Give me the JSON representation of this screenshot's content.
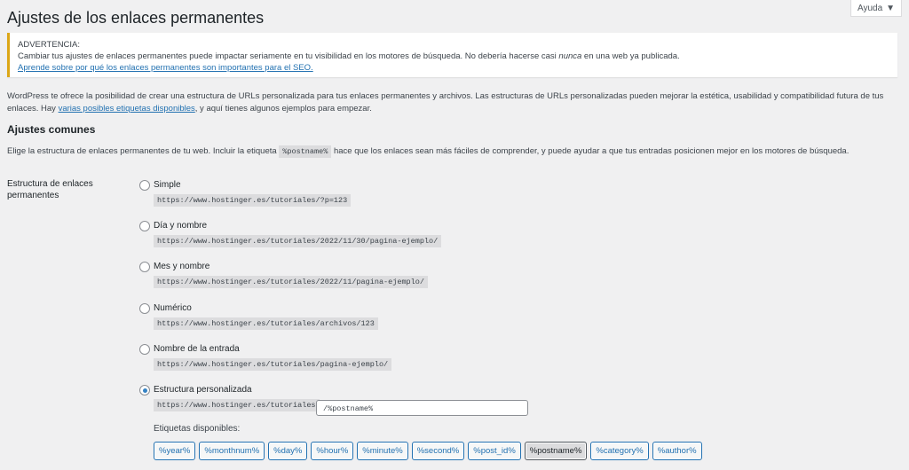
{
  "title": "Ajustes de los enlaces permanentes",
  "help_label": "Ayuda",
  "notice": {
    "heading": "ADVERTENCIA:",
    "text_before": "Cambiar tus ajustes de enlaces permanentes puede impactar seriamente en tu visibilidad en los motores de búsqueda. No debería hacerse casi ",
    "text_em": "nunca",
    "text_after": " en una web ya publicada.",
    "link": "Aprende sobre por qué los enlaces permanentes son importantes para el SEO."
  },
  "intro": {
    "text": "WordPress te ofrece la posibilidad de crear una estructura de URLs personalizada para tus enlaces permanentes y archivos. Las estructuras de URLs personalizadas pueden mejorar la estética, usabilidad y compatibilidad futura de tus enlaces. Hay ",
    "link": "varias posibles etiquetas disponibles",
    "after": ", y aquí tienes algunos ejemplos para empezar."
  },
  "section": {
    "title": "Ajustes comunes",
    "desc_before": "Elige la estructura de enlaces permanentes de tu web. Incluir la etiqueta ",
    "desc_code": "%postname%",
    "desc_after": " hace que los enlaces sean más fáciles de comprender, y puede ayudar a que tus entradas posicionen mejor en los motores de búsqueda."
  },
  "field_label": "Estructura de enlaces permanentes",
  "options": [
    {
      "label": "Simple",
      "example": "https://www.hostinger.es/tutoriales/?p=123",
      "checked": false
    },
    {
      "label": "Día y nombre",
      "example": "https://www.hostinger.es/tutoriales/2022/11/30/pagina-ejemplo/",
      "checked": false
    },
    {
      "label": "Mes y nombre",
      "example": "https://www.hostinger.es/tutoriales/2022/11/pagina-ejemplo/",
      "checked": false
    },
    {
      "label": "Numérico",
      "example": "https://www.hostinger.es/tutoriales/archivos/123",
      "checked": false
    },
    {
      "label": "Nombre de la entrada",
      "example": "https://www.hostinger.es/tutoriales/pagina-ejemplo/",
      "checked": false
    },
    {
      "label": "Estructura personalizada",
      "example": "https://www.hostinger.es/tutoriales",
      "checked": true
    }
  ],
  "custom_value": "/%postname%",
  "tags_label": "Etiquetas disponibles:",
  "tags": [
    "%year%",
    "%monthnum%",
    "%day%",
    "%hour%",
    "%minute%",
    "%second%",
    "%post_id%",
    "%postname%",
    "%category%",
    "%author%"
  ],
  "active_tag": "%postname%"
}
